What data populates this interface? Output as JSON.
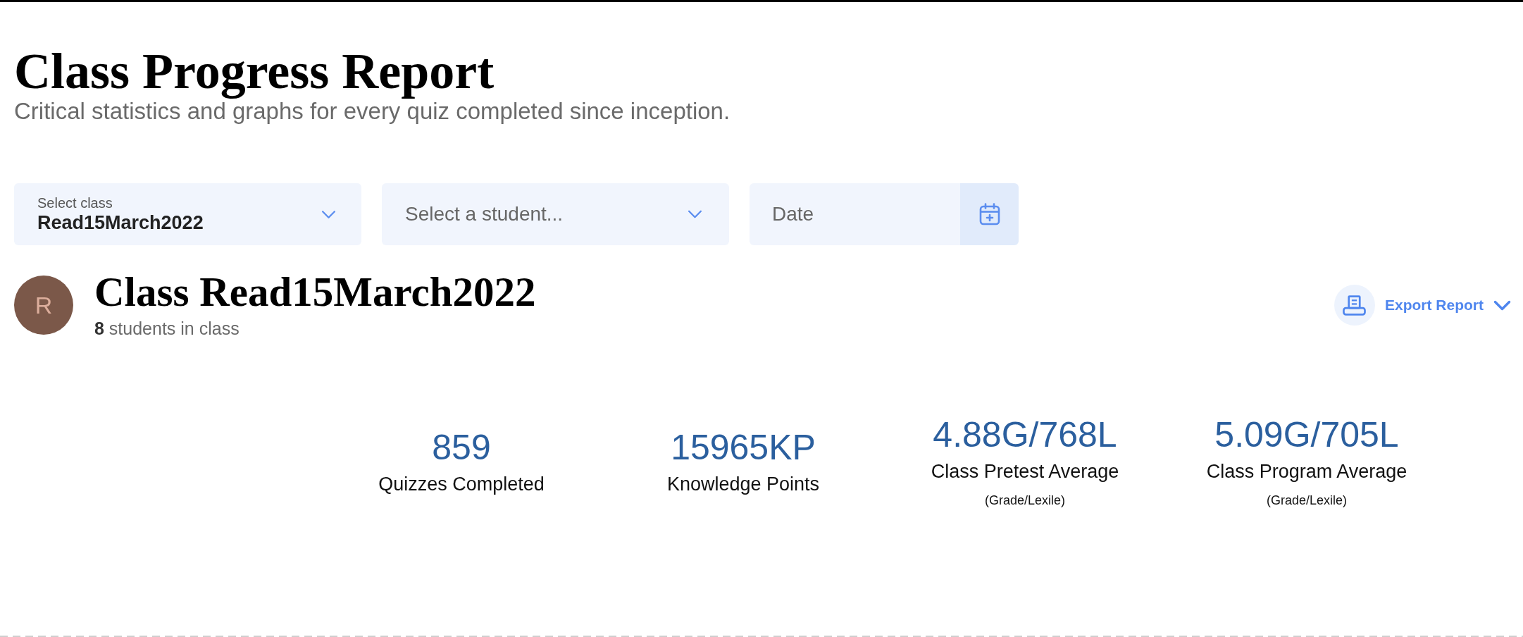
{
  "page": {
    "title": "Class Progress Report",
    "subtitle": "Critical statistics and graphs for every quiz completed since inception."
  },
  "filters": [
    {
      "kind": "select",
      "label": "Select class",
      "value": "Read15March2022"
    },
    {
      "kind": "select",
      "placeholder": "Select a student..."
    },
    {
      "kind": "date",
      "placeholder": "Date"
    }
  ],
  "class_header": {
    "avatar_letter": "R",
    "title": "Class Read15March2022",
    "subtitle": "**8** students in class"
  },
  "export": {
    "label": "Export Report"
  },
  "stats": [
    {
      "value": "859",
      "label": "Quizzes Completed"
    },
    {
      "value": "15965KP",
      "label": "Knowledge Points"
    },
    {
      "value": "4.88G/768L",
      "label": "Class Pretest Average",
      "note": "(Grade/Lexile)"
    },
    {
      "value": "5.09G/705L",
      "label": "Class Program Average",
      "note": "(Grade/Lexile)"
    }
  ]
}
